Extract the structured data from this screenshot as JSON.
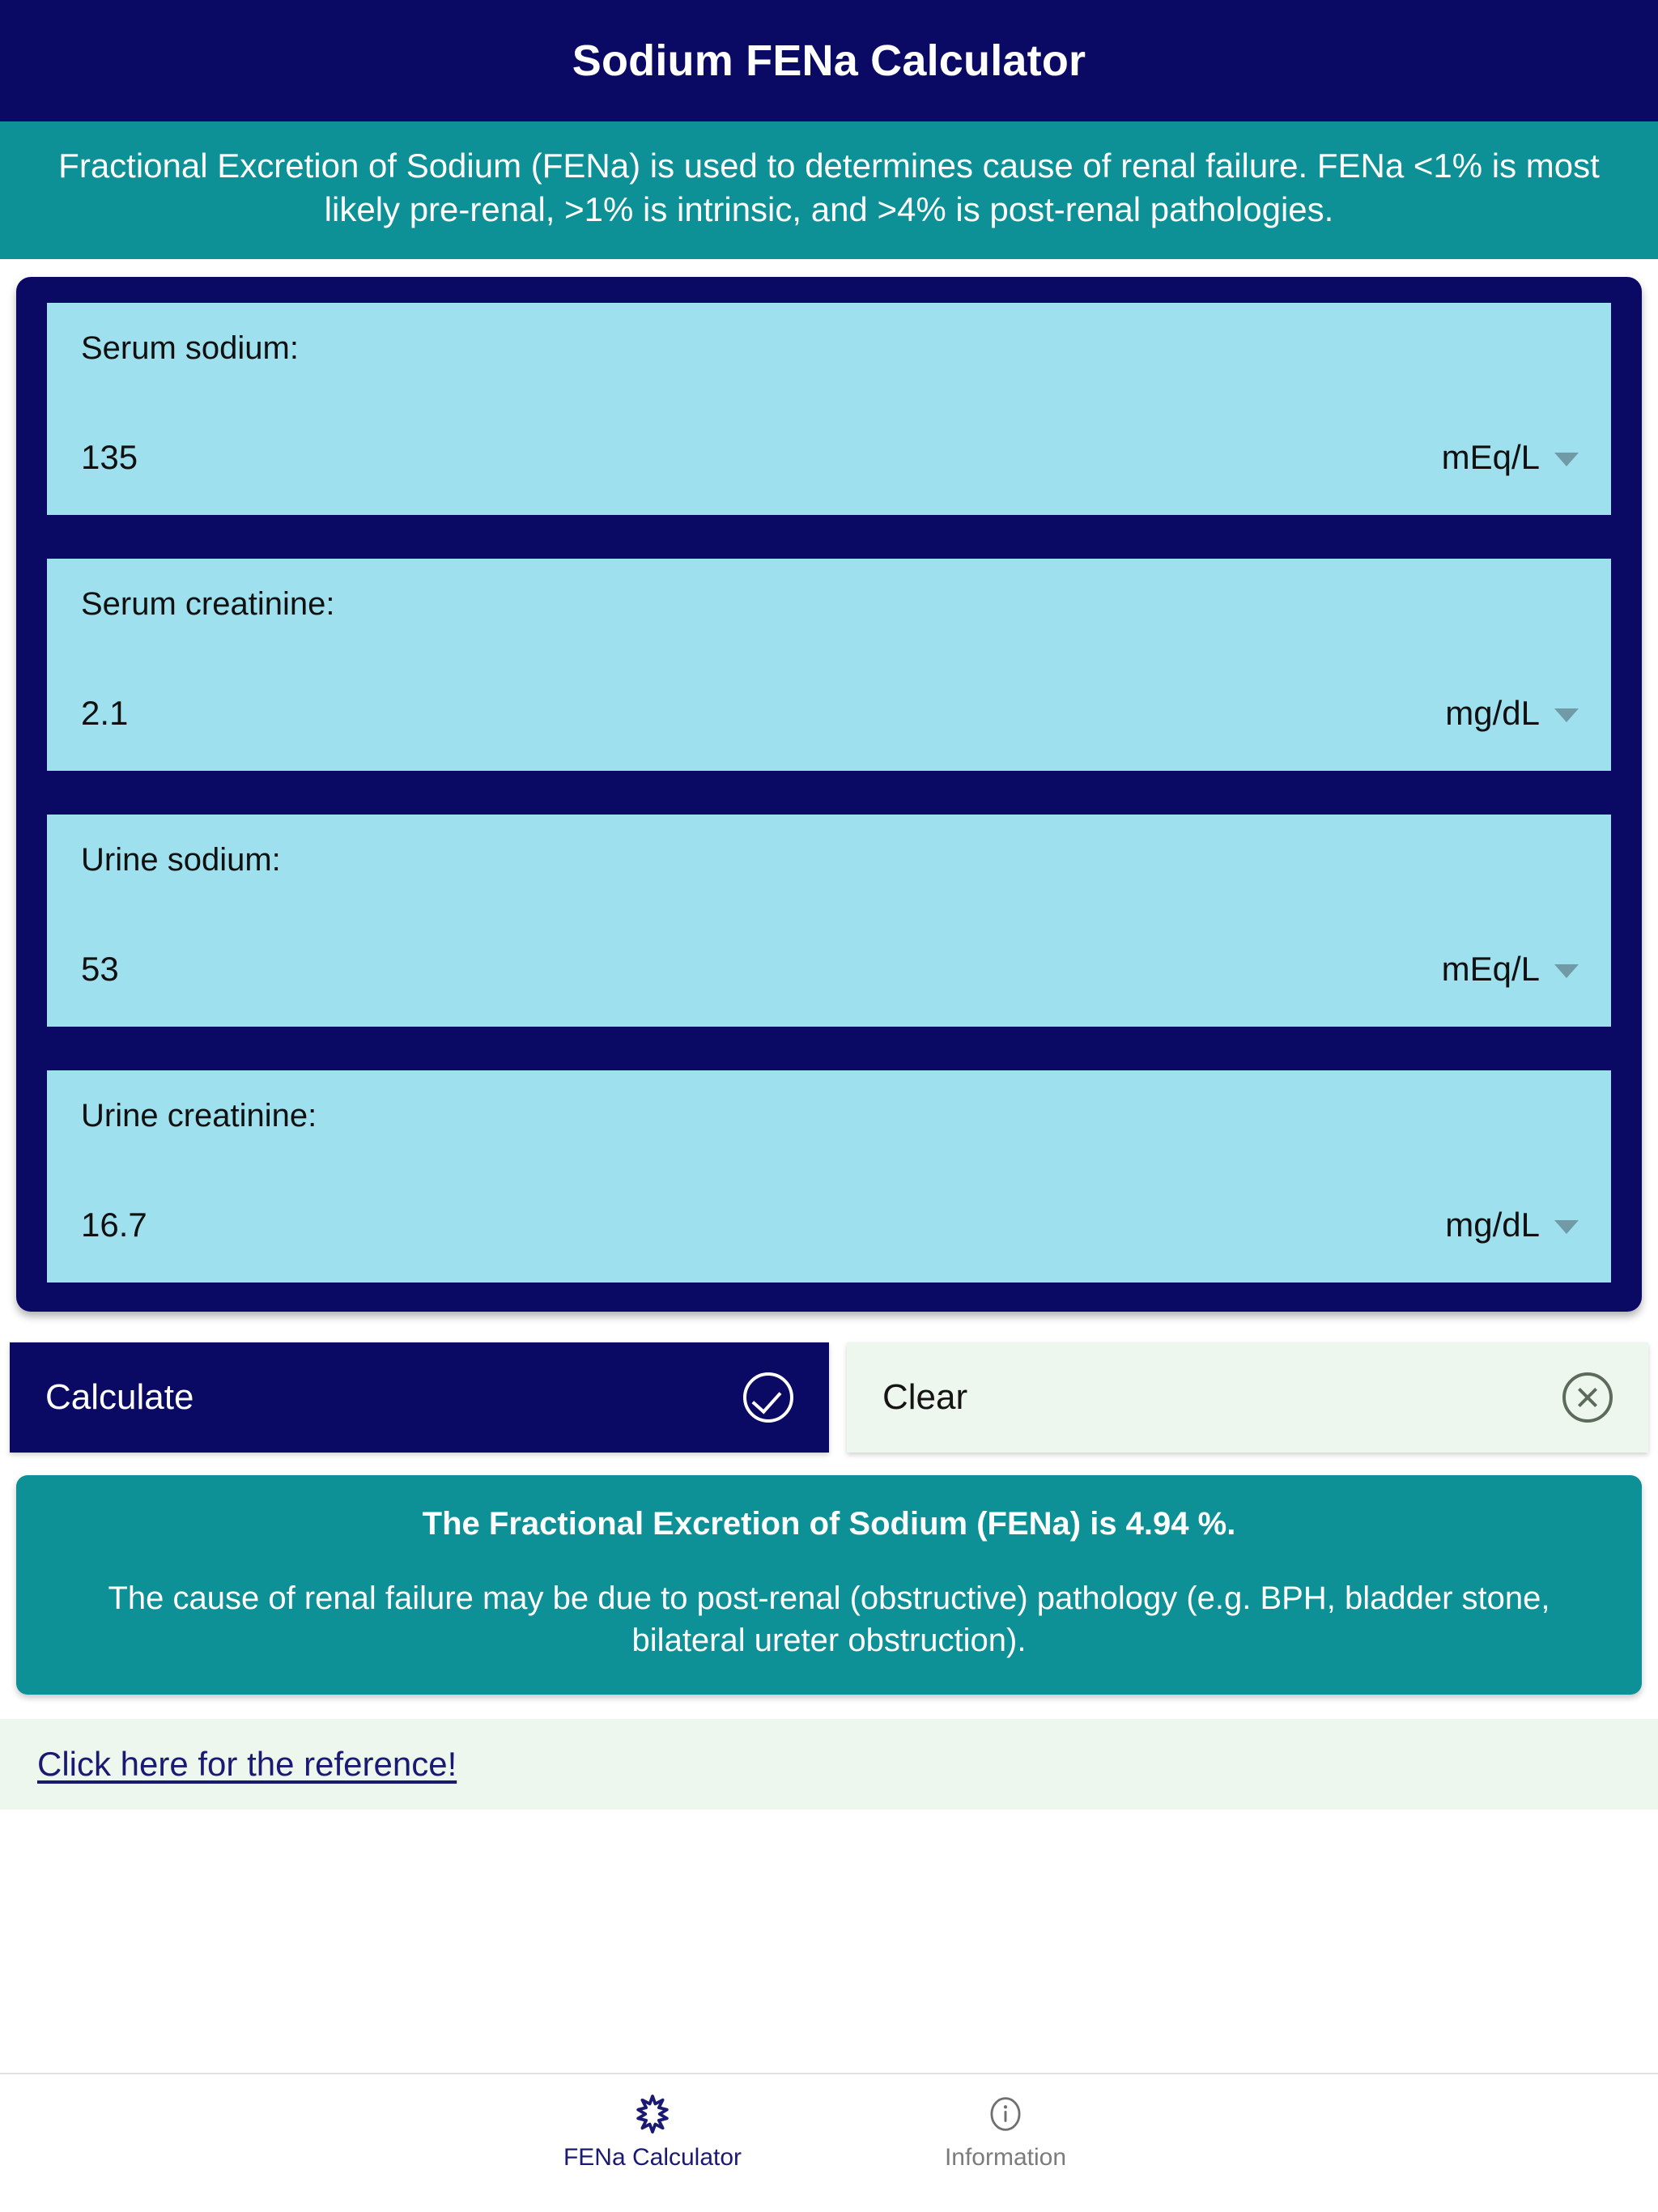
{
  "header": {
    "title": "Sodium FENa Calculator",
    "description": "Fractional Excretion of Sodium (FENa) is used to determines cause of renal failure. FENa <1% is most likely pre-renal, >1% is intrinsic, and >4% is post-renal pathologies."
  },
  "colors": {
    "navy": "#0a0a64",
    "teal": "#0d9096",
    "field_blue": "#9ee0ee",
    "mint": "#eef7ee",
    "link_navy": "#1a1a72",
    "inactive_gray": "#7b7b7b"
  },
  "form": {
    "fields": [
      {
        "label": "Serum sodium:",
        "value": "135",
        "unit": "mEq/L"
      },
      {
        "label": "Serum creatinine:",
        "value": "2.1",
        "unit": "mg/dL"
      },
      {
        "label": "Urine sodium:",
        "value": "53",
        "unit": "mEq/L"
      },
      {
        "label": "Urine creatinine:",
        "value": "16.7",
        "unit": "mg/dL"
      }
    ]
  },
  "actions": {
    "calculate_label": "Calculate",
    "calculate_icon": "check-circle-icon",
    "clear_label": "Clear",
    "clear_icon": "close-circle-icon"
  },
  "result": {
    "headline": "The Fractional Excretion of Sodium (FENa) is 4.94 %.",
    "detail": "The cause of renal failure may be due to post-renal (obstructive) pathology (e.g. BPH, bladder stone, bilateral ureter obstruction).",
    "fena_percent": "4.94"
  },
  "reference": {
    "link_label": "Click here for the reference!"
  },
  "tabbar": {
    "tabs": [
      {
        "label": "FENa Calculator",
        "icon": "star-of-life-icon",
        "active": true
      },
      {
        "label": "Information",
        "icon": "info-circle-icon",
        "active": false
      }
    ]
  }
}
